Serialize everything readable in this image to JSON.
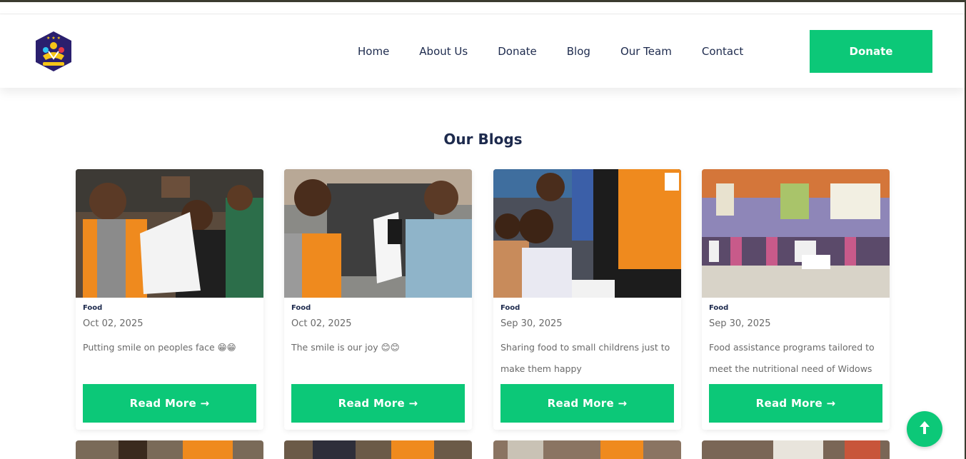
{
  "nav": {
    "links": [
      "Home",
      "About Us",
      "Donate",
      "Blog",
      "Our Team",
      "Contact"
    ],
    "donate_button": "Donate"
  },
  "blogs_section": {
    "title": "Our Blogs",
    "cards": [
      {
        "category": "Food",
        "date": "Oct 02, 2025",
        "text": "Putting smile on peoples face 😁😁",
        "button": "Read More →"
      },
      {
        "category": "Food",
        "date": "Oct 02, 2025",
        "text": "The smile is our joy 😊😊",
        "button": "Read More →"
      },
      {
        "category": "Food",
        "date": "Sep 30, 2025",
        "text": "Sharing food to small childrens just to make them happy",
        "button": "Read More →"
      },
      {
        "category": "Food",
        "date": "Sep 30, 2025",
        "text": "Food assistance programs tailored to meet the nutritional need of Widows",
        "button": "Read More →"
      }
    ]
  },
  "icons": {
    "logo": "organization-logo-icon",
    "scroll_top": "arrow-up-icon"
  },
  "colors": {
    "accent": "#0cc878",
    "heading": "#1d2a4d",
    "muted": "#6a6a6a"
  }
}
